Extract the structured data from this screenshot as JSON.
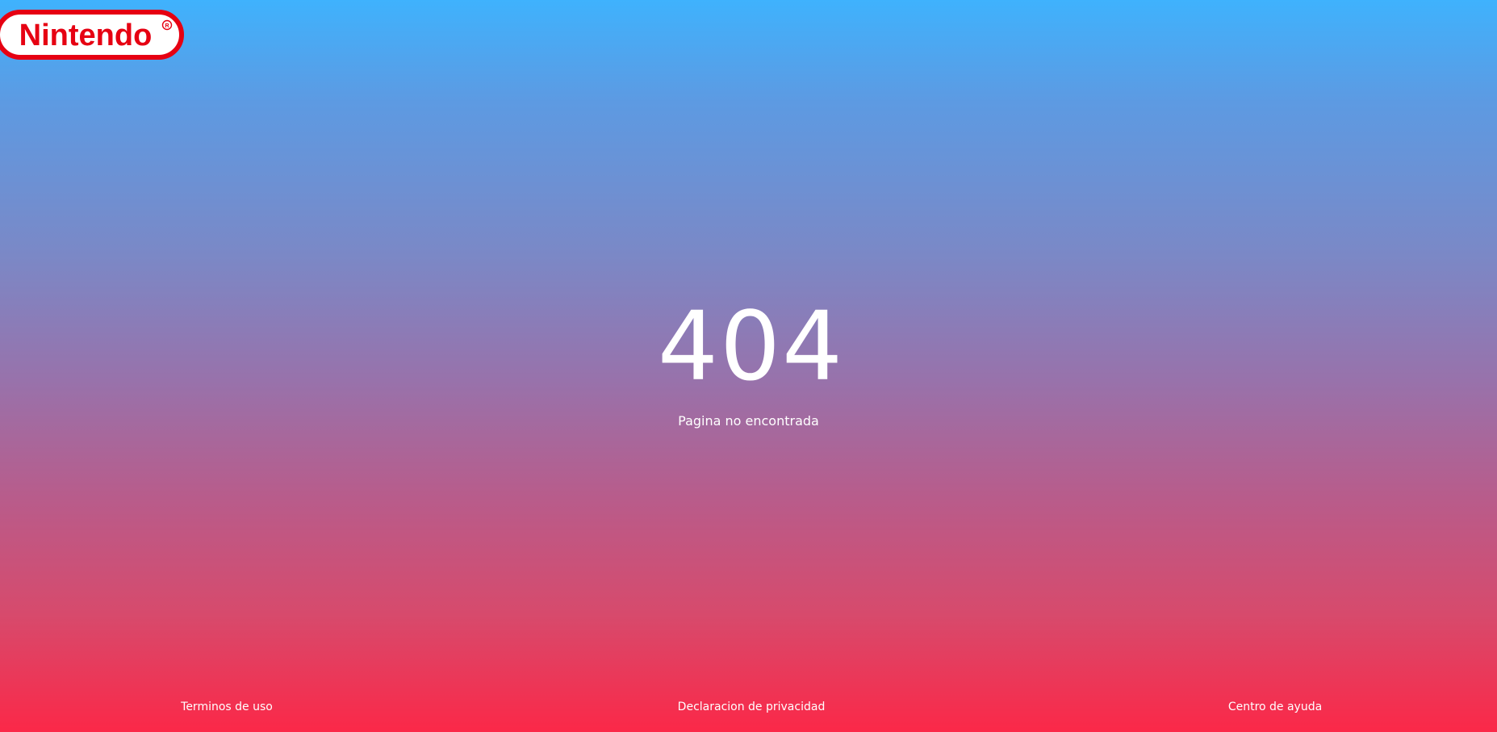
{
  "brand": {
    "name": "Nintendo",
    "logo_text": "Nintendo",
    "color": "#e60012"
  },
  "error": {
    "code": "404",
    "message": "Pagina no encontrada"
  },
  "footer": {
    "links": [
      {
        "label": "Terminos de uso"
      },
      {
        "label": "Declaracion de privacidad"
      },
      {
        "label": "Centro de ayuda"
      }
    ]
  },
  "colors": {
    "gradient_top": "#3fb2fd",
    "gradient_bottom": "#fb2848",
    "text": "#ffffff"
  }
}
